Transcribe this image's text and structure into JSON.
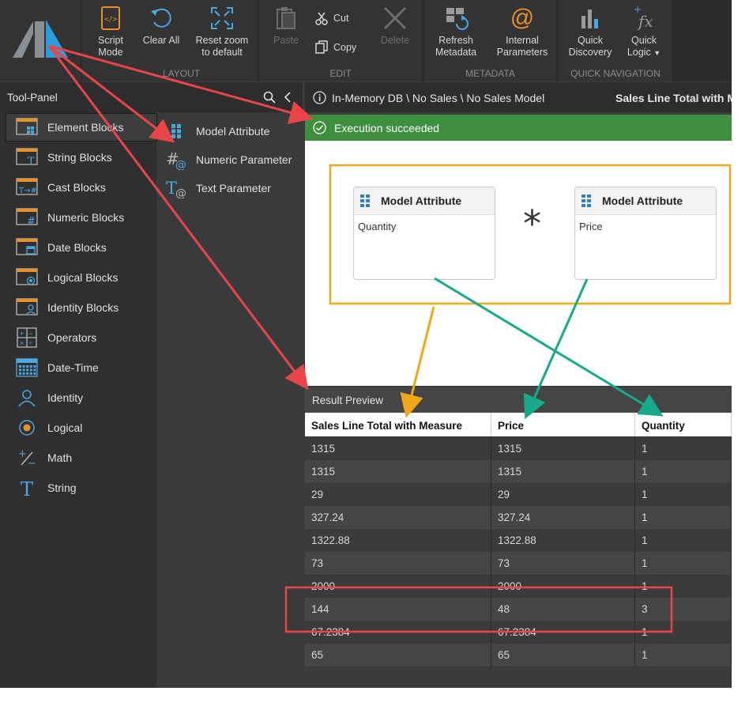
{
  "ribbon": {
    "layout_group": {
      "label": "LAYOUT",
      "buttons": [
        {
          "label": "Script Mode",
          "icon": "script-mode-icon"
        },
        {
          "label": "Clear All",
          "icon": "clear-all-icon"
        },
        {
          "label": "Reset zoom to default",
          "icon": "reset-zoom-icon"
        }
      ]
    },
    "edit_group": {
      "label": "EDIT",
      "paste": "Paste",
      "cut": "Cut",
      "copy": "Copy",
      "delete": "Delete"
    },
    "metadata_group": {
      "label": "METADATA",
      "refresh": "Refresh Metadata",
      "internal": "Internal Parameters",
      "internal_glyph": "@"
    },
    "quicknav_group": {
      "label": "QUICK NAVIGATION",
      "discovery": "Quick Discovery",
      "logic": "Quick Logic",
      "logic_caret": "▼"
    }
  },
  "tool_panel": {
    "title": "Tool-Panel",
    "categories": [
      {
        "label": "Element Blocks",
        "icon": "element-blocks-icon",
        "selected": true
      },
      {
        "label": "String Blocks",
        "icon": "string-blocks-icon"
      },
      {
        "label": "Cast Blocks",
        "icon": "cast-blocks-icon"
      },
      {
        "label": "Numeric Blocks",
        "icon": "numeric-blocks-icon"
      },
      {
        "label": "Date Blocks",
        "icon": "date-blocks-icon"
      },
      {
        "label": "Logical Blocks",
        "icon": "logical-blocks-icon"
      },
      {
        "label": "Identity Blocks",
        "icon": "identity-blocks-icon"
      },
      {
        "label": "Operators",
        "icon": "operators-icon"
      },
      {
        "label": "Date-Time",
        "icon": "date-time-icon"
      },
      {
        "label": "Identity",
        "icon": "identity-icon"
      },
      {
        "label": "Logical",
        "icon": "logical-icon"
      },
      {
        "label": "Math",
        "icon": "math-icon"
      },
      {
        "label": "String",
        "icon": "string-icon"
      }
    ],
    "blocks": [
      {
        "label": "Model Attribute",
        "icon": "model-attribute-icon"
      },
      {
        "label": "Numeric Parameter",
        "icon": "numeric-parameter-icon"
      },
      {
        "label": "Text Parameter",
        "icon": "text-parameter-icon"
      }
    ]
  },
  "main": {
    "breadcrumb": "In-Memory DB \\ No Sales \\ No Sales Model",
    "measure_title": "Sales Line Total with M",
    "status": "Execution succeeded",
    "canvas": {
      "left_node": {
        "title": "Model Attribute",
        "value": "Quantity"
      },
      "operator": "*",
      "right_node": {
        "title": "Model Attribute",
        "value": "Price"
      }
    },
    "result_preview": {
      "title": "Result Preview",
      "columns": [
        "Sales Line Total with Measure",
        "Price",
        "Quantity"
      ],
      "rows": [
        [
          "1315",
          "1315",
          "1"
        ],
        [
          "1315",
          "1315",
          "1"
        ],
        [
          "29",
          "29",
          "1"
        ],
        [
          "327.24",
          "327.24",
          "1"
        ],
        [
          "1322.88",
          "1322.88",
          "1"
        ],
        [
          "73",
          "73",
          "1"
        ],
        [
          "2000",
          "2000",
          "1"
        ],
        [
          "144",
          "48",
          "3"
        ],
        [
          "67.2384",
          "67.2384",
          "1"
        ],
        [
          "65",
          "65",
          "1"
        ]
      ]
    }
  },
  "colors": {
    "success_green": "#3e8e3f",
    "annotation_red": "#e8454a",
    "annotation_orange": "#f0a81a",
    "annotation_teal": "#18a88a",
    "accent_blue": "#2d9cdb"
  }
}
